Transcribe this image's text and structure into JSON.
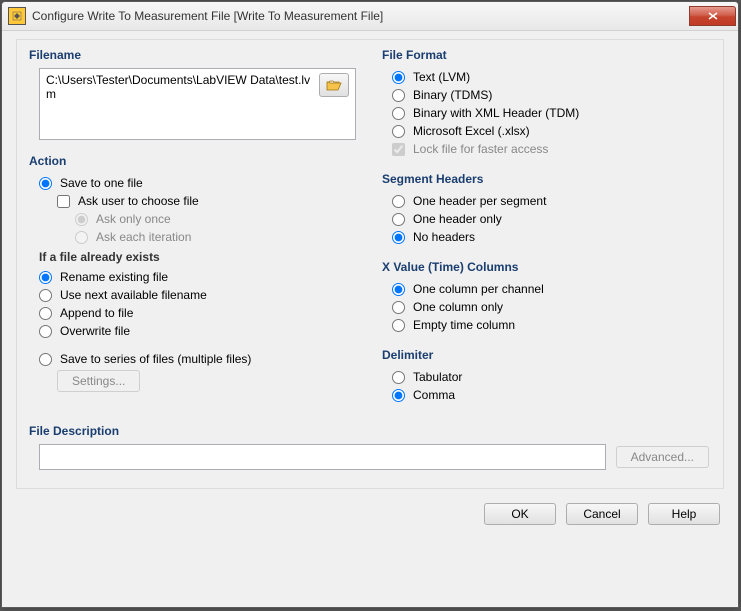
{
  "window": {
    "title": "Configure Write To Measurement File [Write To Measurement File]"
  },
  "filename": {
    "title": "Filename",
    "path": "C:\\Users\\Tester\\Documents\\LabVIEW Data\\test.lvm"
  },
  "action": {
    "title": "Action",
    "save_one": "Save to one file",
    "ask_choose": "Ask user to choose file",
    "ask_once": "Ask only once",
    "ask_each": "Ask each iteration",
    "exists_title": "If a file already exists",
    "rename": "Rename existing file",
    "next": "Use next available filename",
    "append": "Append to file",
    "overwrite": "Overwrite file",
    "save_series": "Save to series of files (multiple files)",
    "settings": "Settings..."
  },
  "format": {
    "title": "File Format",
    "text": "Text (LVM)",
    "tdms": "Binary (TDMS)",
    "tdm": "Binary with XML Header (TDM)",
    "xlsx": "Microsoft Excel (.xlsx)",
    "lock": "Lock file for faster access"
  },
  "segment": {
    "title": "Segment Headers",
    "per": "One header per segment",
    "one": "One header only",
    "none": "No headers"
  },
  "xval": {
    "title": "X Value (Time) Columns",
    "perch": "One column per channel",
    "one": "One column only",
    "empty": "Empty time column"
  },
  "delim": {
    "title": "Delimiter",
    "tab": "Tabulator",
    "comma": "Comma"
  },
  "desc": {
    "title": "File Description",
    "advanced": "Advanced..."
  },
  "buttons": {
    "ok": "OK",
    "cancel": "Cancel",
    "help": "Help"
  }
}
